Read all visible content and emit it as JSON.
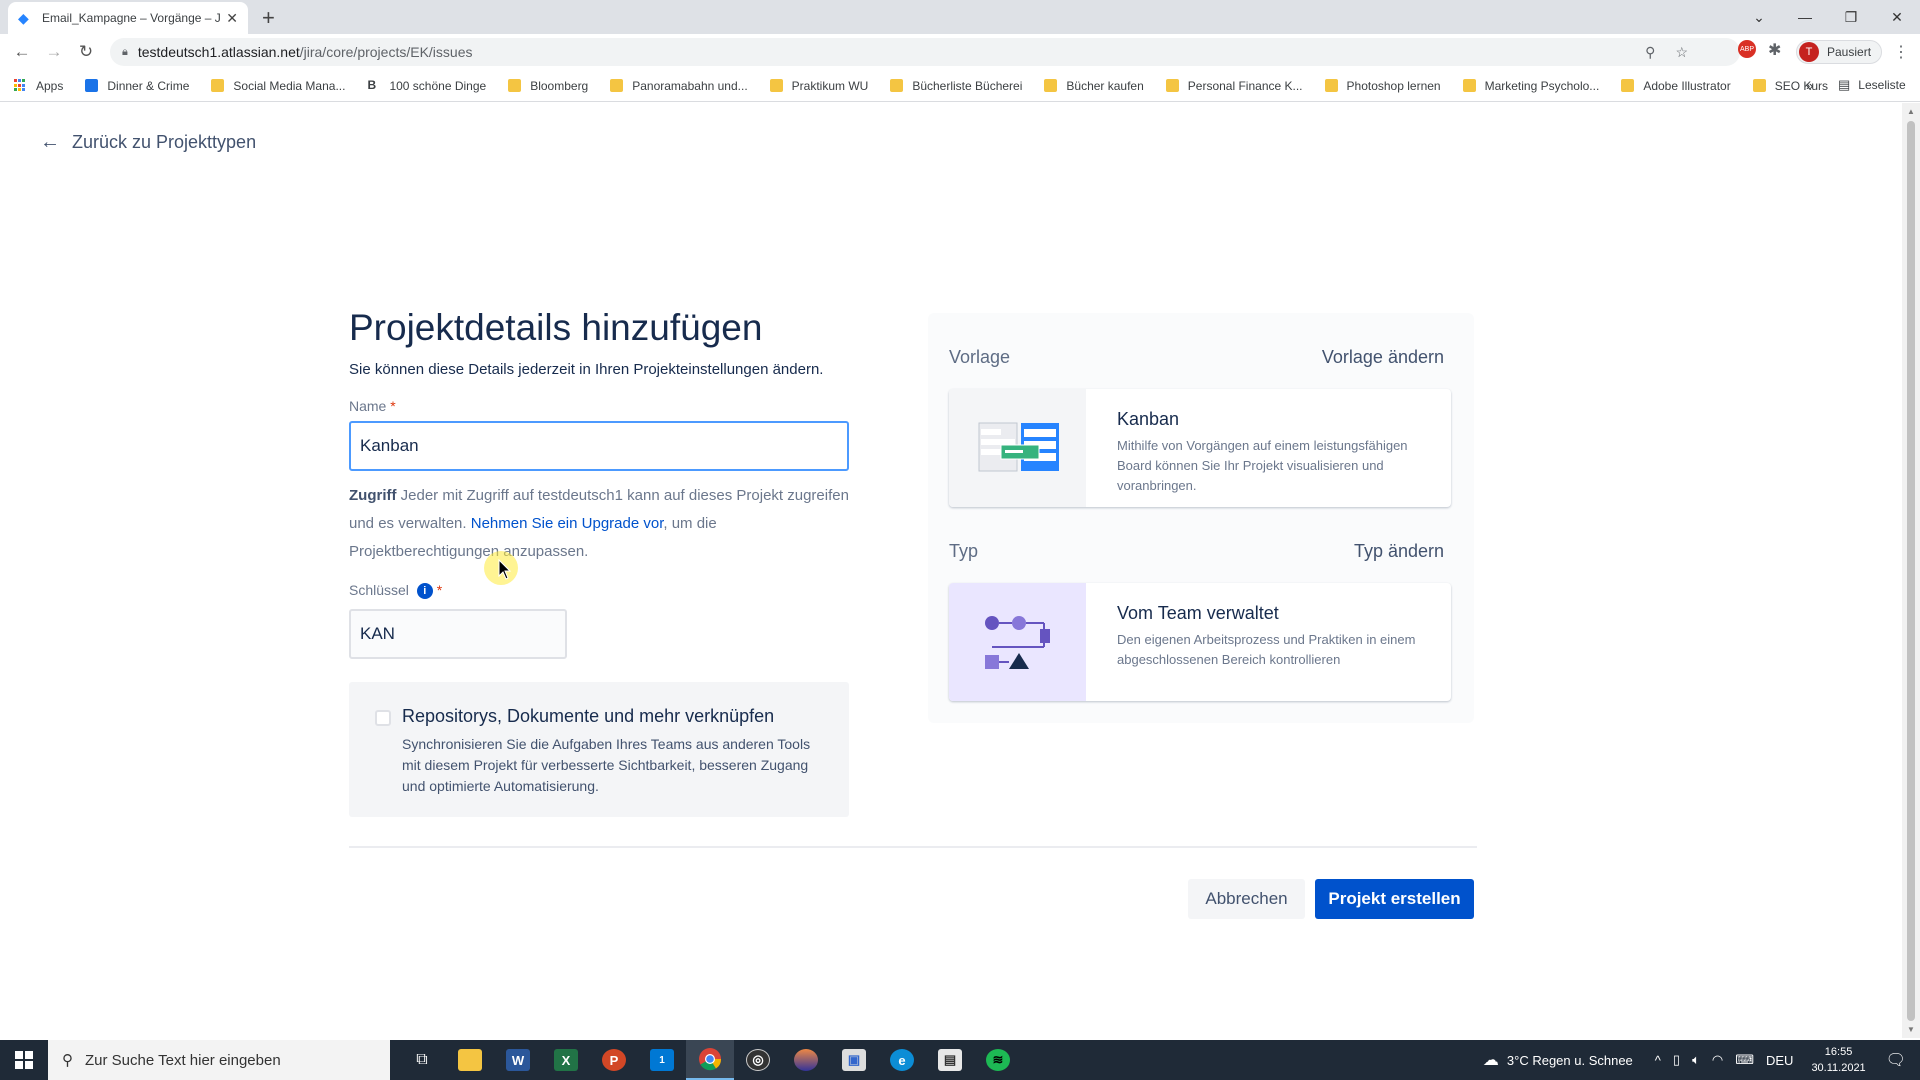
{
  "browser": {
    "tab_title": "Email_Kampagne – Vorgänge – J",
    "url_host": "testdeutsch1.atlassian.net",
    "url_path": "/jira/core/projects/EK/issues",
    "profile_label": "Pausiert",
    "profile_initial": "T",
    "abp_label": "ABP",
    "bookmarks": [
      {
        "label": "Apps",
        "icon": "apps-grid-icon"
      },
      {
        "label": "Dinner & Crime",
        "icon": "site-icon"
      },
      {
        "label": "Social Media Mana...",
        "icon": "folder-icon"
      },
      {
        "label": "100 schöne Dinge",
        "icon": "bold-b-icon"
      },
      {
        "label": "Bloomberg",
        "icon": "folder-icon"
      },
      {
        "label": "Panoramabahn und...",
        "icon": "folder-icon"
      },
      {
        "label": "Praktikum WU",
        "icon": "folder-icon"
      },
      {
        "label": "Bücherliste Bücherei",
        "icon": "folder-icon"
      },
      {
        "label": "Bücher kaufen",
        "icon": "folder-icon"
      },
      {
        "label": "Personal Finance K...",
        "icon": "folder-icon"
      },
      {
        "label": "Photoshop lernen",
        "icon": "folder-icon"
      },
      {
        "label": "Marketing Psycholo...",
        "icon": "folder-icon"
      },
      {
        "label": "Adobe Illustrator",
        "icon": "folder-icon"
      },
      {
        "label": "SEO Kurs",
        "icon": "folder-icon"
      }
    ],
    "reading_list": "Leseliste"
  },
  "page": {
    "back_label": "Zurück zu Projekttypen",
    "title": "Projektdetails hinzufügen",
    "subtitle": "Sie können diese Details jederzeit in Ihren Projekteinstellungen ändern.",
    "name_label": "Name",
    "name_value": "Kanban",
    "access_bold": "Zugriff",
    "access_text_1": " Jeder mit Zugriff auf testdeutsch1 kann auf dieses Projekt zugreifen und es verwalten. ",
    "access_link": "Nehmen Sie ein Upgrade vor",
    "access_text_2": ", um die Projektberechtigungen anzupassen.",
    "key_label": "Schlüssel",
    "key_value": "KAN",
    "required_mark": "*",
    "repo_title": "Repositorys, Dokumente und mehr verknüpfen",
    "repo_desc": "Synchronisieren Sie die Aufgaben Ihres Teams aus anderen Tools mit diesem Projekt für verbesserte Sichtbarkeit, besseren Zugang und optimierte Automatisierung.",
    "cancel_label": "Abbrechen",
    "create_label": "Projekt erstellen"
  },
  "panel": {
    "template_heading": "Vorlage",
    "template_change": "Vorlage ändern",
    "template_name": "Kanban",
    "template_desc": "Mithilfe von Vorgängen auf einem leistungsfähigen Board können Sie Ihr Projekt visualisieren und voranbringen.",
    "type_heading": "Typ",
    "type_change": "Typ ändern",
    "type_name": "Vom Team verwaltet",
    "type_desc": "Den eigenen Arbeitsprozess und Praktiken in einem abgeschlossenen Bereich kontrollieren"
  },
  "taskbar": {
    "search_placeholder": "Zur Suche Text hier eingeben",
    "weather": "3°C  Regen u. Schnee",
    "language": "DEU",
    "time": "16:55",
    "date": "30.11.2021",
    "mail_badge": "1"
  },
  "colors": {
    "primary": "#0052cc",
    "focus_border": "#4c9aff",
    "heading": "#172b4d"
  }
}
